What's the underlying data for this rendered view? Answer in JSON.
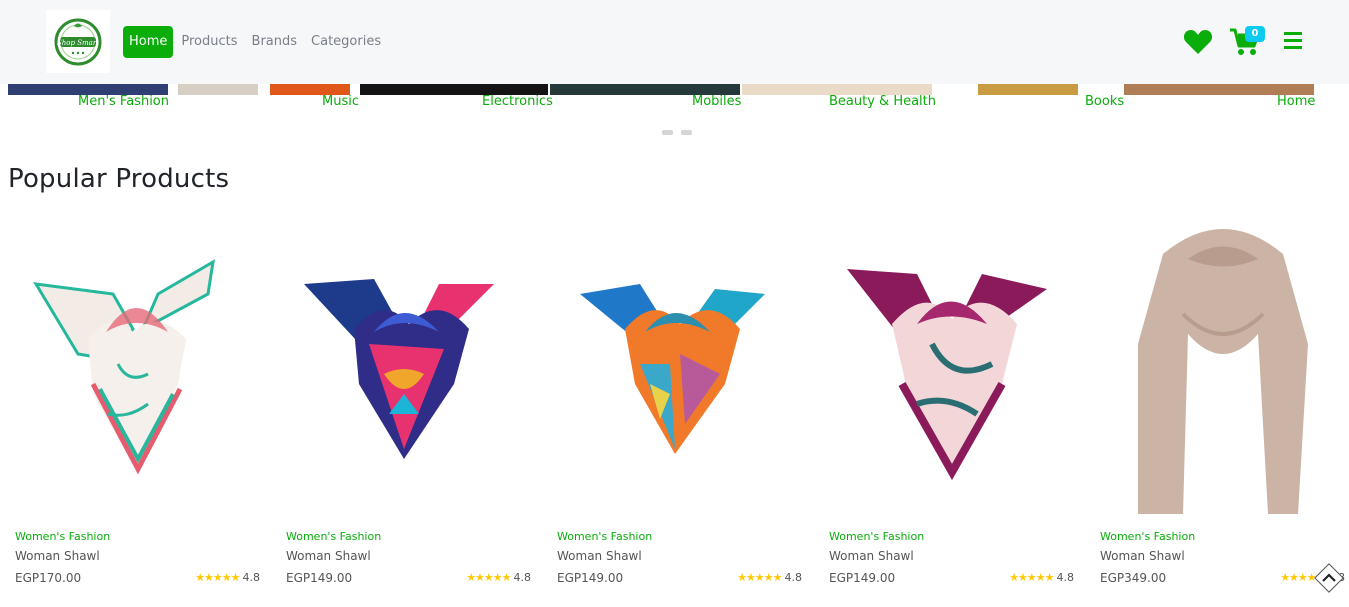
{
  "brand": {
    "logo_text": "Shop Smart",
    "accent_color": "#0aad0a"
  },
  "nav": {
    "links": [
      {
        "label": "Home",
        "active": true
      },
      {
        "label": "Products",
        "active": false
      },
      {
        "label": "Brands",
        "active": false
      },
      {
        "label": "Categories",
        "active": false
      }
    ],
    "cart_count": "0",
    "icons": [
      "heart-icon",
      "cart-icon",
      "menu-icon"
    ]
  },
  "categories": [
    {
      "label": "Men's Fashion"
    },
    {
      "label": "Music"
    },
    {
      "label": "Electronics"
    },
    {
      "label": "Mobiles"
    },
    {
      "label": "Beauty & Health"
    },
    {
      "label": "Books"
    },
    {
      "label": "Home"
    }
  ],
  "section_title": "Popular Products",
  "products": [
    {
      "category": "Women's Fashion",
      "name": "Woman Shawl",
      "price": "EGP170.00",
      "rating": "4.8"
    },
    {
      "category": "Women's Fashion",
      "name": "Woman Shawl",
      "price": "EGP149.00",
      "rating": "4.8"
    },
    {
      "category": "Women's Fashion",
      "name": "Woman Shawl",
      "price": "EGP149.00",
      "rating": "4.8"
    },
    {
      "category": "Women's Fashion",
      "name": "Woman Shawl",
      "price": "EGP149.00",
      "rating": "4.8"
    },
    {
      "category": "Women's Fashion",
      "name": "Woman Shawl",
      "price": "EGP349.00",
      "rating": "4.8"
    }
  ]
}
